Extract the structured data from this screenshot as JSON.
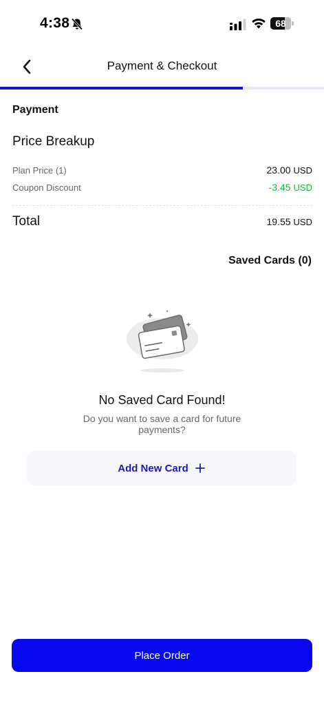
{
  "status_bar": {
    "time": "4:38",
    "battery": "68",
    "icons": [
      "bell-muted-icon",
      "signal-icon",
      "wifi-icon",
      "battery-icon"
    ]
  },
  "header": {
    "back_icon": "chevron-left-icon",
    "title": "Payment & Checkout"
  },
  "progress": {
    "fraction": 0.75
  },
  "payment": {
    "section_label": "Payment",
    "breakup_title": "Price Breakup",
    "rows": [
      {
        "label": "Plan Price (1)",
        "amount": "23.00",
        "currency": "USD"
      },
      {
        "label": "Coupon Discount",
        "amount": "-3.45",
        "currency": "USD"
      }
    ],
    "total": {
      "label": "Total",
      "amount": "19.55",
      "currency": "USD"
    }
  },
  "saved_cards": {
    "label": "Saved Cards (0)",
    "illustration_icon": "credit-cards-illustration",
    "empty_title": "No Saved Card Found!",
    "empty_subtitle": "Do you want to save a card for future payments?",
    "add_button_label": "Add New Card",
    "add_icon": "plus-icon"
  },
  "footer": {
    "place_order_label": "Place Order"
  },
  "colors": {
    "accent": "#0808ee",
    "progress": "#1616c8",
    "discount": "#22b04b",
    "add_button_text": "#1b1aa8"
  }
}
